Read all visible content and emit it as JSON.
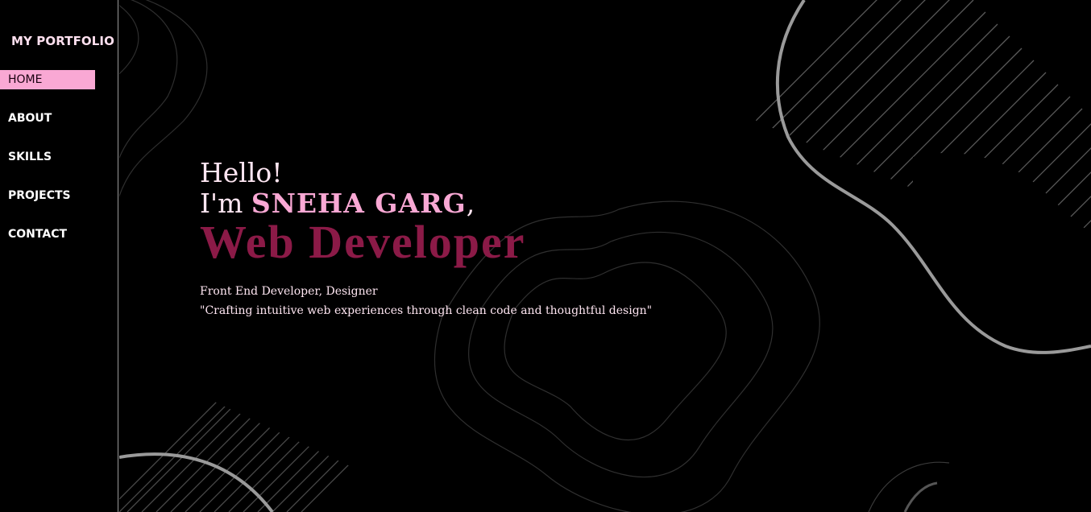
{
  "sidebar": {
    "brand": "MY PORTFOLIO",
    "items": [
      {
        "label": "HOME",
        "active": true
      },
      {
        "label": "ABOUT"
      },
      {
        "label": "SKILLS"
      },
      {
        "label": "PROJECTS"
      },
      {
        "label": "CONTACT"
      }
    ]
  },
  "hero": {
    "greeting": "Hello!",
    "intro_prefix": "I'm ",
    "name": "SNEHA GARG",
    "intro_suffix": ",",
    "role": "Web Developer",
    "subtitle": "Front End Developer, Designer",
    "quote": "\"Crafting intuitive web experiences through clean code and thoughtful design\""
  },
  "colors": {
    "background": "#000000",
    "accent_pink": "#f9a8d4",
    "role_maroon": "#8b1a47",
    "text_light": "#ffe6f2"
  }
}
